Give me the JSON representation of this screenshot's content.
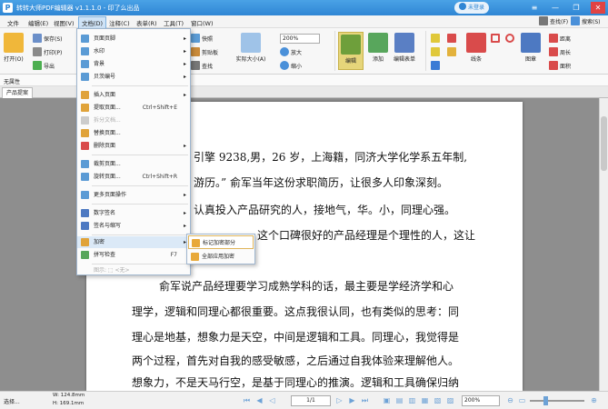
{
  "app": {
    "title": "转转大师PDF编辑器 v1.1.1.0 - 印了么出品",
    "logo_letter": "P",
    "login": "未登录"
  },
  "window_controls": [
    "≡",
    "—",
    "❐",
    "✕"
  ],
  "menu": [
    "文件",
    "编辑(E)",
    "视图(V)",
    "文档(D)",
    "注释(C)",
    "表单(R)",
    "工具(T)",
    "窗口(W)"
  ],
  "toolbar": {
    "open": "打开(O)",
    "save": "保存(S)",
    "print": "打印(P)",
    "export": "导出",
    "snapshot": "快照",
    "clipboard": "剪贴板",
    "find": "查找",
    "actual_size": "实际大小(A)",
    "zoom_value": "200%",
    "zoom_in": "放大",
    "zoom_out": "缩小",
    "edit": "编辑",
    "add": "添加",
    "edit_form": "编辑表单",
    "line": "线条",
    "shapes": "图章",
    "distance": "距离",
    "perimeter": "周长",
    "area": "面积",
    "find_right": "查找(F)",
    "search_right": "搜索(S)"
  },
  "props_bar": "无属性",
  "doc_tab": "产品提案",
  "document_menu": {
    "items": [
      {
        "label": "页面页脚",
        "arrow": "▸",
        "shortcut": ""
      },
      {
        "label": "水印",
        "arrow": "▸",
        "shortcut": ""
      },
      {
        "label": "背景",
        "arrow": "▸",
        "shortcut": ""
      },
      {
        "label": "贝茨编号",
        "arrow": "▸",
        "shortcut": ""
      },
      {
        "label": "插入页面",
        "arrow": "▸",
        "shortcut": ""
      },
      {
        "label": "提取页面...",
        "arrow": "",
        "shortcut": "Ctrl+Shift+E"
      },
      {
        "label": "拆分文档...",
        "arrow": "",
        "shortcut": ""
      },
      {
        "label": "替换页面...",
        "arrow": "",
        "shortcut": ""
      },
      {
        "label": "删除页面",
        "arrow": "▸",
        "shortcut": ""
      },
      {
        "label": "裁剪页面...",
        "arrow": "",
        "shortcut": ""
      },
      {
        "label": "旋转页面...",
        "arrow": "",
        "shortcut": "Ctrl+Shift+R"
      },
      {
        "label": "更多页面操作",
        "arrow": "▸",
        "shortcut": ""
      },
      {
        "label": "数字签名",
        "arrow": "▸",
        "shortcut": ""
      },
      {
        "label": "签名与缩写",
        "arrow": "▸",
        "shortcut": ""
      },
      {
        "label": "加密",
        "arrow": "▸",
        "shortcut": ""
      },
      {
        "label": "拼写检查",
        "arrow": "",
        "shortcut": "F7"
      }
    ],
    "footer": "图示: ⬚ <无>"
  },
  "encrypt_submenu": [
    "标记加密部分",
    "全部应用加密"
  ],
  "document_lines": [
    "引擎 9238,男，26 岁，上海籍，同济大学化学系五年制,",
    "游历。” 俞军当年这份求职简历，让很多人印象深刻。",
    "认真投入产品研究的人，接地气，华。小，同理心强。",
    "这个口碑很好的产品经理是个理性的人，这让",
    "俞军说产品经理要学习成熟学科的话，最主要是学经济学和心",
    "理学，逻辑和同理心都很重要。这点我很认同，也有类似的思考：同",
    "理心是地基，想象力是天空，中间是逻辑和工具。同理心，我觉得是",
    "两个过程，首先对自我的感受敏感，之后通过自我体验来理解他人。",
    "想象力，不是天马行空，是基于同理心的推演。逻辑和工具确保归纳"
  ],
  "status": {
    "select_tool": "选择...",
    "width": "W: 124.8mm",
    "height": "H: 169.1mm",
    "page_indicator": "1/1",
    "zoom": "200%"
  },
  "colors": {
    "title_bar": "#2f86d4",
    "menu_active": "#cfe3f6",
    "workspace": "#8e8e8e",
    "highlight": "#dbe9f7"
  }
}
